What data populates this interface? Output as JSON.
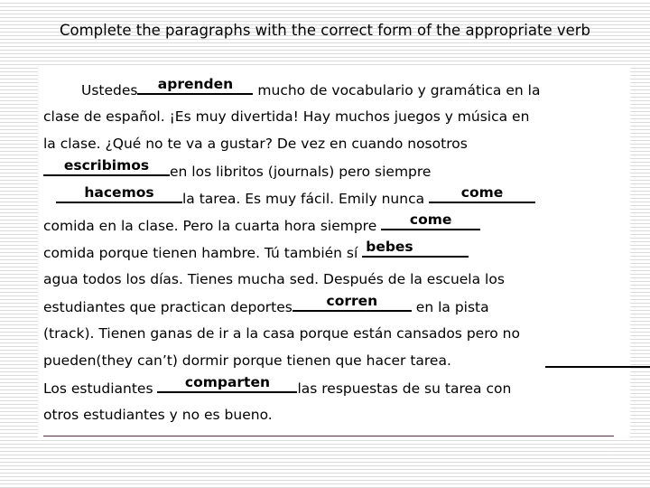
{
  "slide": {
    "title": "Complete the paragraphs with the correct form of the appropriate verb",
    "accent_rule_color": "#7b2430",
    "text_color": "#000000",
    "background_color": "#ffffff"
  },
  "paragraph": {
    "lines": [
      {
        "id": "line-1",
        "segments": [
          {
            "type": "text",
            "value": "Ustedes"
          },
          {
            "type": "blank",
            "answer": "aprenden"
          },
          {
            "type": "text",
            "value": " mucho de vocabulario y gramática en la"
          }
        ]
      },
      {
        "id": "line-2",
        "segments": [
          {
            "type": "text",
            "value": "clase de español. ¡Es muy divertida! Hay muchos juegos y música en"
          }
        ]
      },
      {
        "id": "line-3",
        "segments": [
          {
            "type": "text",
            "value": "la clase. ¿Qué no te va a gustar? De vez en cuando nosotros"
          }
        ]
      },
      {
        "id": "line-4",
        "segments": [
          {
            "type": "blank",
            "answer": "escribimos"
          },
          {
            "type": "text",
            "value": "en los libritos (journals) pero siempre"
          }
        ]
      },
      {
        "id": "line-5",
        "segments": [
          {
            "type": "blank",
            "answer": "hacemos"
          },
          {
            "type": "text",
            "value": "la tarea. Es muy fácil.  Emily nunca "
          },
          {
            "type": "blank",
            "answer": "come"
          }
        ]
      },
      {
        "id": "line-6",
        "segments": [
          {
            "type": "text",
            "value": "comida en la clase. Pero la cuarta hora siempre "
          },
          {
            "type": "blank",
            "answer": "come"
          }
        ]
      },
      {
        "id": "line-7",
        "segments": [
          {
            "type": "text",
            "value": "comida porque tienen hambre.  Tú también sí "
          },
          {
            "type": "blank",
            "answer": "bebes"
          }
        ]
      },
      {
        "id": "line-8",
        "segments": [
          {
            "type": "text",
            "value": "agua todos los días. Tienes mucha sed. Después de la escuela los"
          }
        ]
      },
      {
        "id": "line-9",
        "segments": [
          {
            "type": "text",
            "value": "estudiantes que practican deportes"
          },
          {
            "type": "blank",
            "answer": "corren"
          },
          {
            "type": "text",
            "value": " en la pista"
          }
        ]
      },
      {
        "id": "line-10",
        "segments": [
          {
            "type": "text",
            "value": "(track). Tienen ganas de ir a la casa porque están cansados pero no"
          }
        ]
      },
      {
        "id": "line-11",
        "segments": [
          {
            "type": "text",
            "value": "pueden(they can’t) dormir porque tienen que hacer tarea. "
          },
          {
            "type": "blank",
            "answer": ""
          }
        ]
      },
      {
        "id": "line-12",
        "segments": [
          {
            "type": "text",
            "value": "Los estudiantes "
          },
          {
            "type": "blank",
            "answer": "comparten"
          },
          {
            "type": "text",
            "value": "las respuestas de su tarea con"
          }
        ]
      },
      {
        "id": "line-13",
        "segments": [
          {
            "type": "text",
            "value": "otros estudiantes y no es bueno."
          }
        ]
      }
    ],
    "answers": [
      "aprenden",
      "escribimos",
      "hacemos",
      "come",
      "come",
      "bebes",
      "corren",
      "comparten"
    ]
  }
}
